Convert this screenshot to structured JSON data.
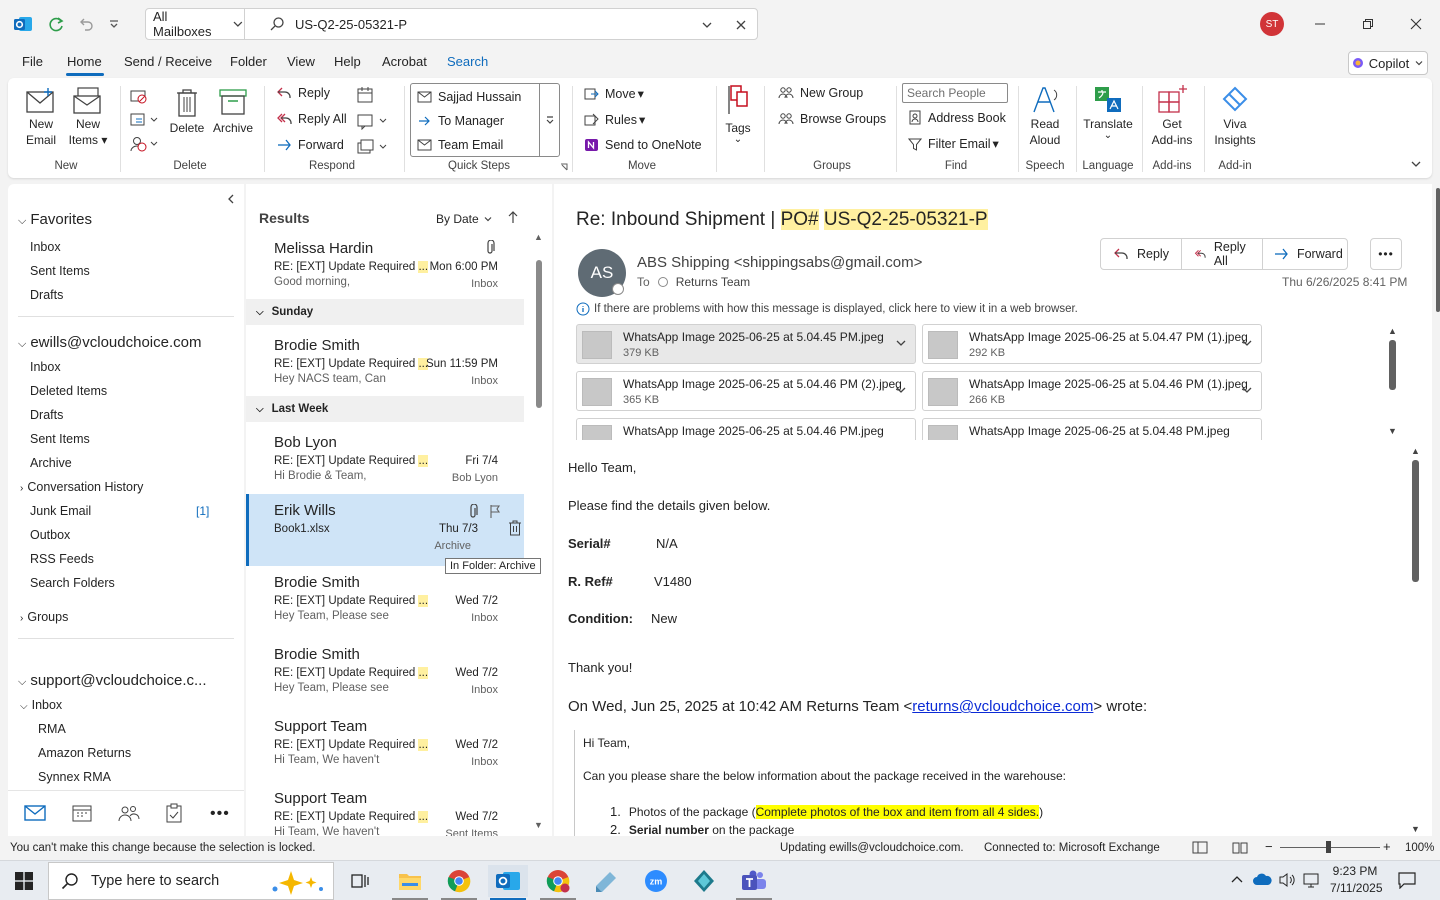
{
  "titlebar": {
    "mailbox": "All Mailboxes",
    "search_value": "US-Q2-25-05321-P",
    "user_initials": "ST"
  },
  "menu": {
    "tabs": [
      "File",
      "Home",
      "Send / Receive",
      "Folder",
      "View",
      "Help",
      "Acrobat",
      "Search"
    ],
    "copilot": "Copilot"
  },
  "ribbon": {
    "new_email": [
      "New",
      "Email"
    ],
    "new_items": [
      "New",
      "Items"
    ],
    "group_new": "New",
    "delete": "Delete",
    "archive": "Archive",
    "group_delete": "Delete",
    "reply": "Reply",
    "reply_all": "Reply All",
    "forward": "Forward",
    "group_respond": "Respond",
    "qs1": "Sajjad Hussain",
    "qs2": "To Manager",
    "qs3": "Team Email",
    "group_quicksteps": "Quick Steps",
    "move": "Move",
    "rules": "Rules",
    "onenote": "Send to OneNote",
    "group_move": "Move",
    "tags": "Tags",
    "new_group": "New Group",
    "browse_groups": "Browse Groups",
    "group_groups": "Groups",
    "search_people": "Search People",
    "address_book": "Address Book",
    "filter_email": "Filter Email",
    "group_find": "Find",
    "read_aloud": [
      "Read",
      "Aloud"
    ],
    "group_speech": "Speech",
    "translate": "Translate",
    "group_language": "Language",
    "get_addins": [
      "Get",
      "Add-ins"
    ],
    "group_addins": "Add-ins",
    "viva": [
      "Viva",
      "Insights"
    ],
    "group_addin": "Add-in"
  },
  "folders": {
    "favorites_title": "Favorites",
    "favorites": [
      "Inbox",
      "Sent Items",
      "Drafts"
    ],
    "account1": "ewills@vcloudchoice.com",
    "account1_items": [
      "Inbox",
      "Deleted Items",
      "Drafts",
      "Sent Items",
      "Archive",
      "Conversation History",
      "Junk Email",
      "Outbox",
      "RSS Feeds",
      "Search Folders"
    ],
    "junk_count": "[1]",
    "groups": "Groups",
    "account2": "support@vcloudchoice.c...",
    "account2_inbox": "Inbox",
    "account2_sub": [
      "RMA",
      "Amazon Returns",
      "Synnex RMA"
    ]
  },
  "list": {
    "title": "Results",
    "sort": "By Date",
    "groups": [
      "Sunday",
      "Last Week"
    ],
    "messages": [
      {
        "name": "Melissa Hardin",
        "subject": "RE: [EXT] Update Required ",
        "date": "Mon 6:00 PM",
        "preview": "Good morning,",
        "folder": "Inbox"
      },
      {
        "name": "Brodie Smith",
        "subject": "RE: [EXT] Update Required ",
        "date": "Sun 11:59 PM",
        "preview": "Hey NACS team,  Can",
        "folder": "Inbox"
      },
      {
        "name": "Bob Lyon",
        "subject": "RE: [EXT] Update Required ",
        "date": "Fri 7/4",
        "preview": "Hi Brodie & Team,",
        "folder": "Bob Lyon"
      },
      {
        "name": "Erik Wills",
        "subject": "Book1.xlsx",
        "date": "Thu 7/3",
        "preview": "",
        "folder": "Archive"
      },
      {
        "name": "Brodie Smith",
        "subject": "RE: [EXT] Update Required ",
        "date": "Wed 7/2",
        "preview": "Hey Team,  Please see",
        "folder": "Inbox"
      },
      {
        "name": "Brodie Smith",
        "subject": "RE: [EXT] Update Required ",
        "date": "Wed 7/2",
        "preview": "Hey Team,  Please see",
        "folder": "Inbox"
      },
      {
        "name": "Support Team",
        "subject": "RE: [EXT] Update Required ",
        "date": "Wed 7/2",
        "preview": "Hi Team,  We haven't",
        "folder": "Inbox"
      },
      {
        "name": "Support Team",
        "subject": "RE: [EXT] Update Required ",
        "date": "Wed 7/2",
        "preview": "Hi Team,  We haven't",
        "folder": "Sent Items"
      }
    ],
    "tooltip": "In Folder: Archive"
  },
  "reading": {
    "subject_prefix": "Re: Inbound Shipment | ",
    "subject_po": "PO#",
    "subject_id": "US-Q2-25-05321-P",
    "sender_initials": "AS",
    "sender": "ABS Shipping <shippingsabs@gmail.com>",
    "to_label": "To",
    "to": "Returns Team",
    "date": "Thu 6/26/2025 8:41 PM",
    "btn_reply": "Reply",
    "btn_replyall": "Reply All",
    "btn_forward": "Forward",
    "info": "If there are problems with how this message is displayed, click here to view it in a web browser.",
    "attachments": [
      {
        "name": "WhatsApp Image 2025-06-25 at 5.04.45 PM.jpeg",
        "size": "379 KB"
      },
      {
        "name": "WhatsApp Image 2025-06-25 at 5.04.47 PM (1).jpeg",
        "size": "292 KB"
      },
      {
        "name": "WhatsApp Image 2025-06-25 at 5.04.46 PM (2).jpeg",
        "size": "365 KB"
      },
      {
        "name": "WhatsApp Image 2025-06-25 at 5.04.46 PM (1).jpeg",
        "size": "266 KB"
      },
      {
        "name": "WhatsApp Image 2025-06-25 at 5.04.46 PM.jpeg",
        "size": ""
      },
      {
        "name": "WhatsApp Image 2025-06-25 at 5.04.48 PM.jpeg",
        "size": ""
      }
    ],
    "greeting": "Hello Team,",
    "intro": "Please find the details given below.",
    "serial_label": "Serial#",
    "serial_value": "N/A",
    "rref_label": "R. Ref#",
    "rref_value": "V1480",
    "cond_label": "Condition:",
    "cond_value": "New",
    "thanks": "Thank you!",
    "quote_head_a": "On Wed, Jun 25, 2025 at 10:42 AM Returns Team <",
    "quote_email": "returns@vcloudchoice.com",
    "quote_head_b": "> wrote:",
    "q_hi": "Hi Team,",
    "q_ask": "Can you please share the below information about the package received in the warehouse:",
    "q1_a": "Photos of the package (",
    "q1_hl": "Complete photos of the box and item from all 4 sides.",
    "q1_b": ")",
    "q2_bold": "Serial number",
    "q2_rest": " on the package"
  },
  "status": {
    "left": "You can't make this change because the selection is locked.",
    "updating": "Updating ewills@vcloudchoice.com.",
    "connected": "Connected to: Microsoft Exchange",
    "zoom": "100%"
  },
  "taskbar": {
    "search": "Type here to search",
    "time": "9:23 PM",
    "date": "7/11/2025"
  },
  "colors": {
    "accent": "#0f6cbd",
    "highlight": "#fff0a0",
    "selected": "#cfe4f7",
    "avatar_st": "#d13438",
    "avatar_as": "#5f6b74"
  }
}
